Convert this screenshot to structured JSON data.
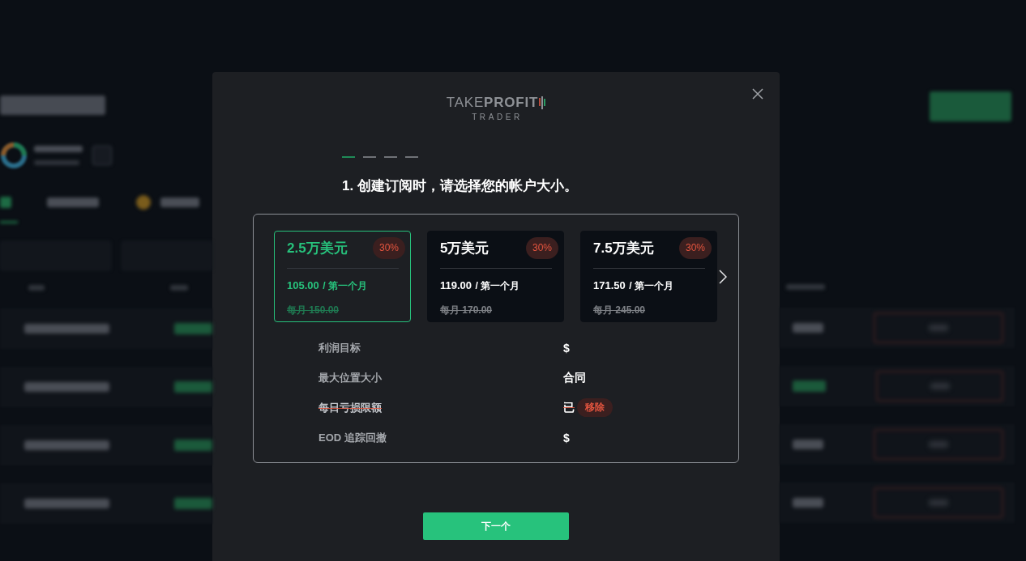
{
  "modal": {
    "logo": {
      "wordmark": "TAKE**PROFIT**",
      "subtitle": "TRADER"
    },
    "steps": [
      {
        "selected": true
      },
      {
        "selected": false
      },
      {
        "selected": false
      },
      {
        "selected": false
      }
    ],
    "title": "1. 创建订阅时，请选择您的帐户大小。",
    "plans": [
      {
        "name": "2.5万美元",
        "discount": "30%",
        "price": "105.00",
        "period": "/ 第一个月",
        "original": "每月 150.00",
        "selected": true
      },
      {
        "name": "5万美元",
        "discount": "30%",
        "price": "119.00",
        "period": "/ 第一个月",
        "original": "每月 170.00",
        "selected": false
      },
      {
        "name": "7.5万美元",
        "discount": "30%",
        "price": "171.50",
        "period": "/ 第一个月",
        "original": "每月 245.00",
        "selected": false
      }
    ],
    "details": [
      {
        "label": "利润目标",
        "value": "$",
        "removed": false
      },
      {
        "label": "最大位置大小",
        "value": "合同",
        "removed": false
      },
      {
        "label": "每日亏损限额",
        "value": "已",
        "removed": true,
        "badge": "移除"
      },
      {
        "label": "EOD 追踪回撤",
        "value": "$",
        "removed": false
      }
    ],
    "next_button": "下一个"
  }
}
